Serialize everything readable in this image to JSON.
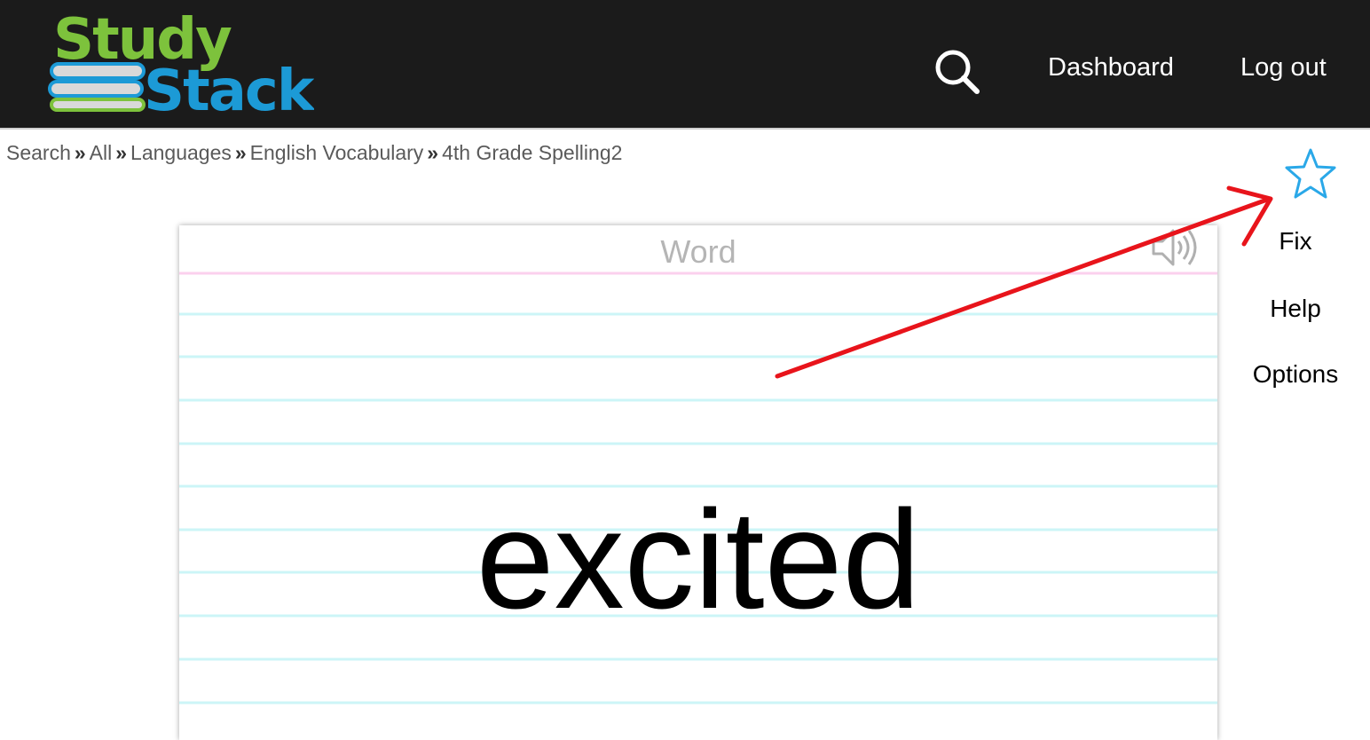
{
  "header": {
    "logo_top_text": "Study",
    "logo_bottom_text": "Stack",
    "logo_top_color": "#7dc23c",
    "logo_bottom_color": "#1c9ad6",
    "dashboard_label": "Dashboard",
    "logout_label": "Log out",
    "search_icon": "search-icon"
  },
  "breadcrumb": {
    "items": [
      "Search",
      "All",
      "Languages",
      "English Vocabulary",
      "4th Grade Spelling2"
    ],
    "separator": "»"
  },
  "card": {
    "heading": "Word",
    "term": "excited",
    "speaker_icon": "speaker-icon",
    "line_color": "#ccf5f7",
    "header_line_color": "#fbd0ee"
  },
  "sidebar": {
    "star_icon": "star-icon",
    "star_color": "#2aa8e8",
    "fix_label": "Fix",
    "help_label": "Help",
    "options_label": "Options"
  },
  "annotation": {
    "arrow_color": "#e8141b"
  }
}
